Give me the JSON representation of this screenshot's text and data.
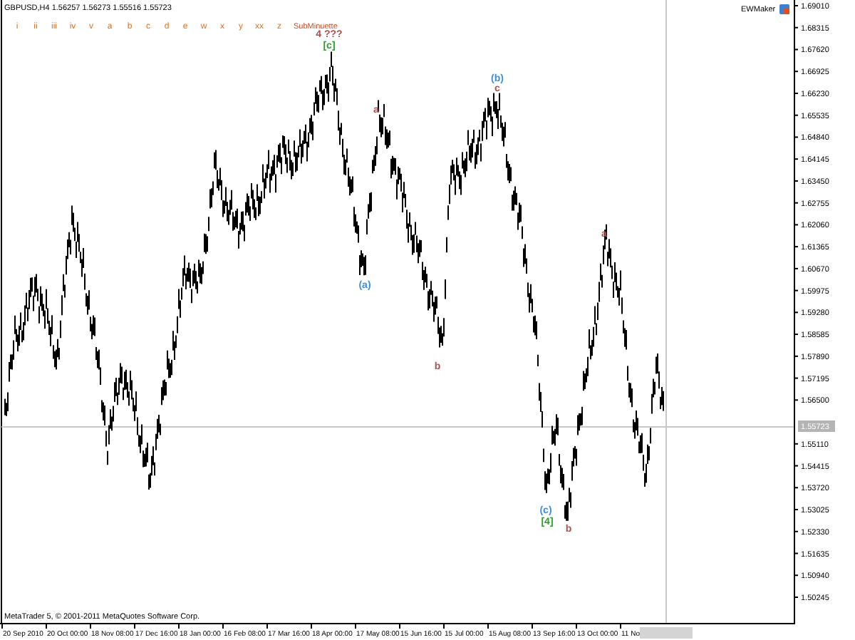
{
  "header": {
    "symbol_info": "GBPUSD,H4 1.56257 1.56273 1.55516 1.55723"
  },
  "wave_tools": [
    "i",
    "ii",
    "iii",
    "iv",
    "v",
    "a",
    "b",
    "c",
    "d",
    "e",
    "w",
    "x",
    "y",
    "xx",
    "z"
  ],
  "degree": "SubMinuette",
  "indicator": {
    "name": "EWMaker"
  },
  "wave_labels": [
    {
      "text": "4 ???",
      "color": "#b05050"
    },
    {
      "text": "[c]",
      "color": "#2e9e2e"
    },
    {
      "text": "a",
      "color": "#b05050"
    },
    {
      "text": "(a)",
      "color": "#3c8fe0"
    },
    {
      "text": "b",
      "color": "#b05050"
    },
    {
      "text": "(b)",
      "color": "#3c8fe0"
    },
    {
      "text": "c",
      "color": "#b05050"
    },
    {
      "text": "a",
      "color": "#b05050"
    },
    {
      "text": "(c)",
      "color": "#3c8fe0"
    },
    {
      "text": "[4]",
      "color": "#2e9e2e"
    },
    {
      "text": "b",
      "color": "#b05050"
    }
  ],
  "price_axis": [
    "1.69010",
    "1.68315",
    "1.67620",
    "1.66925",
    "1.66230",
    "1.65535",
    "1.64840",
    "1.64145",
    "1.63450",
    "1.62755",
    "1.62060",
    "1.61365",
    "1.60670",
    "1.59975",
    "1.59280",
    "1.58585",
    "1.57890",
    "1.57195",
    "1.56500",
    "1.55110",
    "1.54415",
    "1.53720",
    "1.53025",
    "1.52330",
    "1.51635",
    "1.50940",
    "1.50245"
  ],
  "current_price": "1.55723",
  "time_axis": [
    "20 Sep 2010",
    "20 Oct 00:00",
    "18 Nov 08:00",
    "17 Dec 16:00",
    "18 Jan 00:00",
    "16 Feb 08:00",
    "17 Mar 16:00",
    "18 Apr 00:00",
    "17 May 08:00",
    "15 Jun 16:00",
    "15 Jul 00:00",
    "15 Aug 08:00",
    "13 Sep 16:00",
    "13 Oct 00:00",
    "11 No"
  ],
  "copyright": "MetaTrader 5, © 2001-2011 MetaQuotes Software Corp."
}
